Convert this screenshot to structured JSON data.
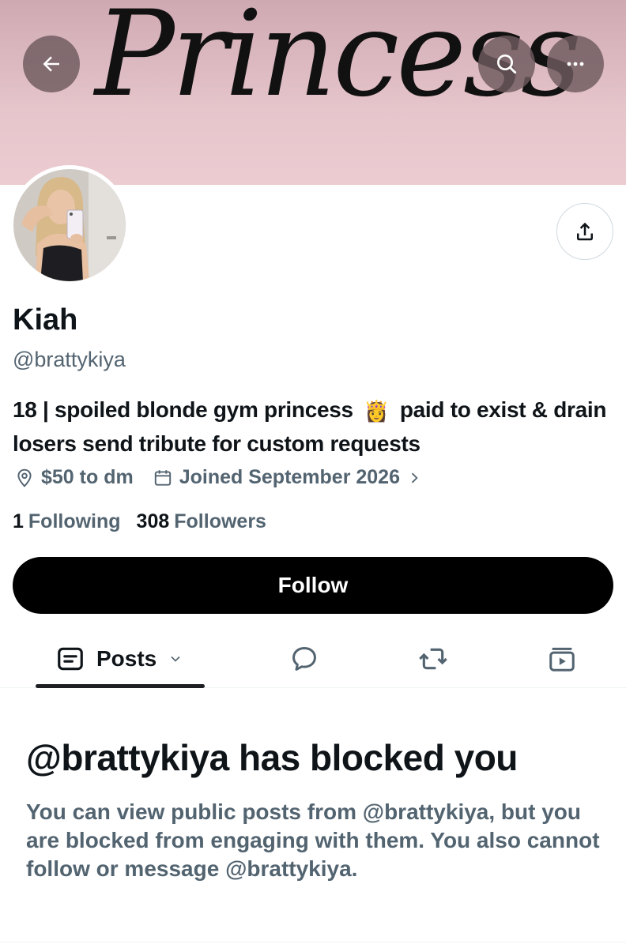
{
  "header": {
    "banner_text": "Princess",
    "back_icon": "arrow-left-icon",
    "search_icon": "search-icon",
    "more_icon": "more-horizontal-icon",
    "share_icon": "share-icon"
  },
  "profile": {
    "name": "Kiah",
    "handle": "@brattykiya",
    "bio_part1": "18 | spoiled blonde gym princess",
    "bio_emoji": "👸",
    "bio_part2": "paid to exist & drain losers send tribute for custom requests",
    "location": "$50 to dm",
    "joined": "Joined September 2026",
    "following_count": "1",
    "following_label": "Following",
    "followers_count": "308",
    "followers_label": "Followers"
  },
  "actions": {
    "follow_label": "Follow"
  },
  "tabs": {
    "posts_label": "Posts",
    "items": [
      "posts",
      "replies",
      "reposts",
      "media"
    ]
  },
  "blocked": {
    "title": "@brattykiya has blocked you",
    "message": "You can view public posts from @brattykiya, but you are blocked from engaging with them. You also cannot follow or message @brattykiya."
  },
  "colors": {
    "banner": "#e6c5cb",
    "text_primary": "#0f1419",
    "text_secondary": "#536471",
    "button_bg": "#000000"
  }
}
